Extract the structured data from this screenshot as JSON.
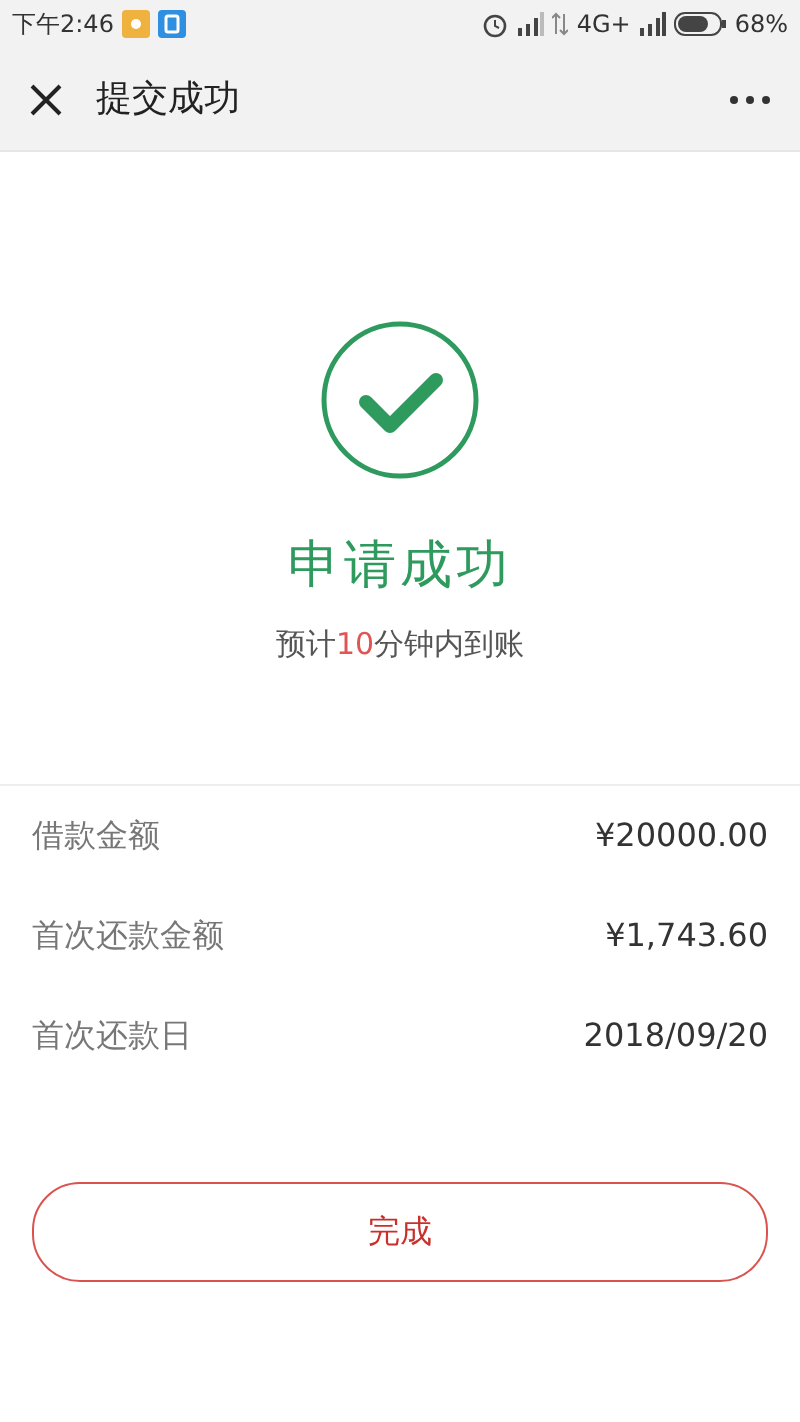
{
  "status_bar": {
    "time": "下午2:46",
    "network": "4G+",
    "battery": "68%"
  },
  "header": {
    "title": "提交成功"
  },
  "result": {
    "title": "申请成功",
    "eta": {
      "before": "预计",
      "highlight": "10",
      "after": "分钟内到账"
    }
  },
  "details": [
    {
      "label": "借款金额",
      "value": "¥20000.00"
    },
    {
      "label": "首次还款金额",
      "value": "¥1,743.60"
    },
    {
      "label": "首次还款日",
      "value": "2018/09/20"
    }
  ],
  "button": {
    "label": "完成"
  }
}
